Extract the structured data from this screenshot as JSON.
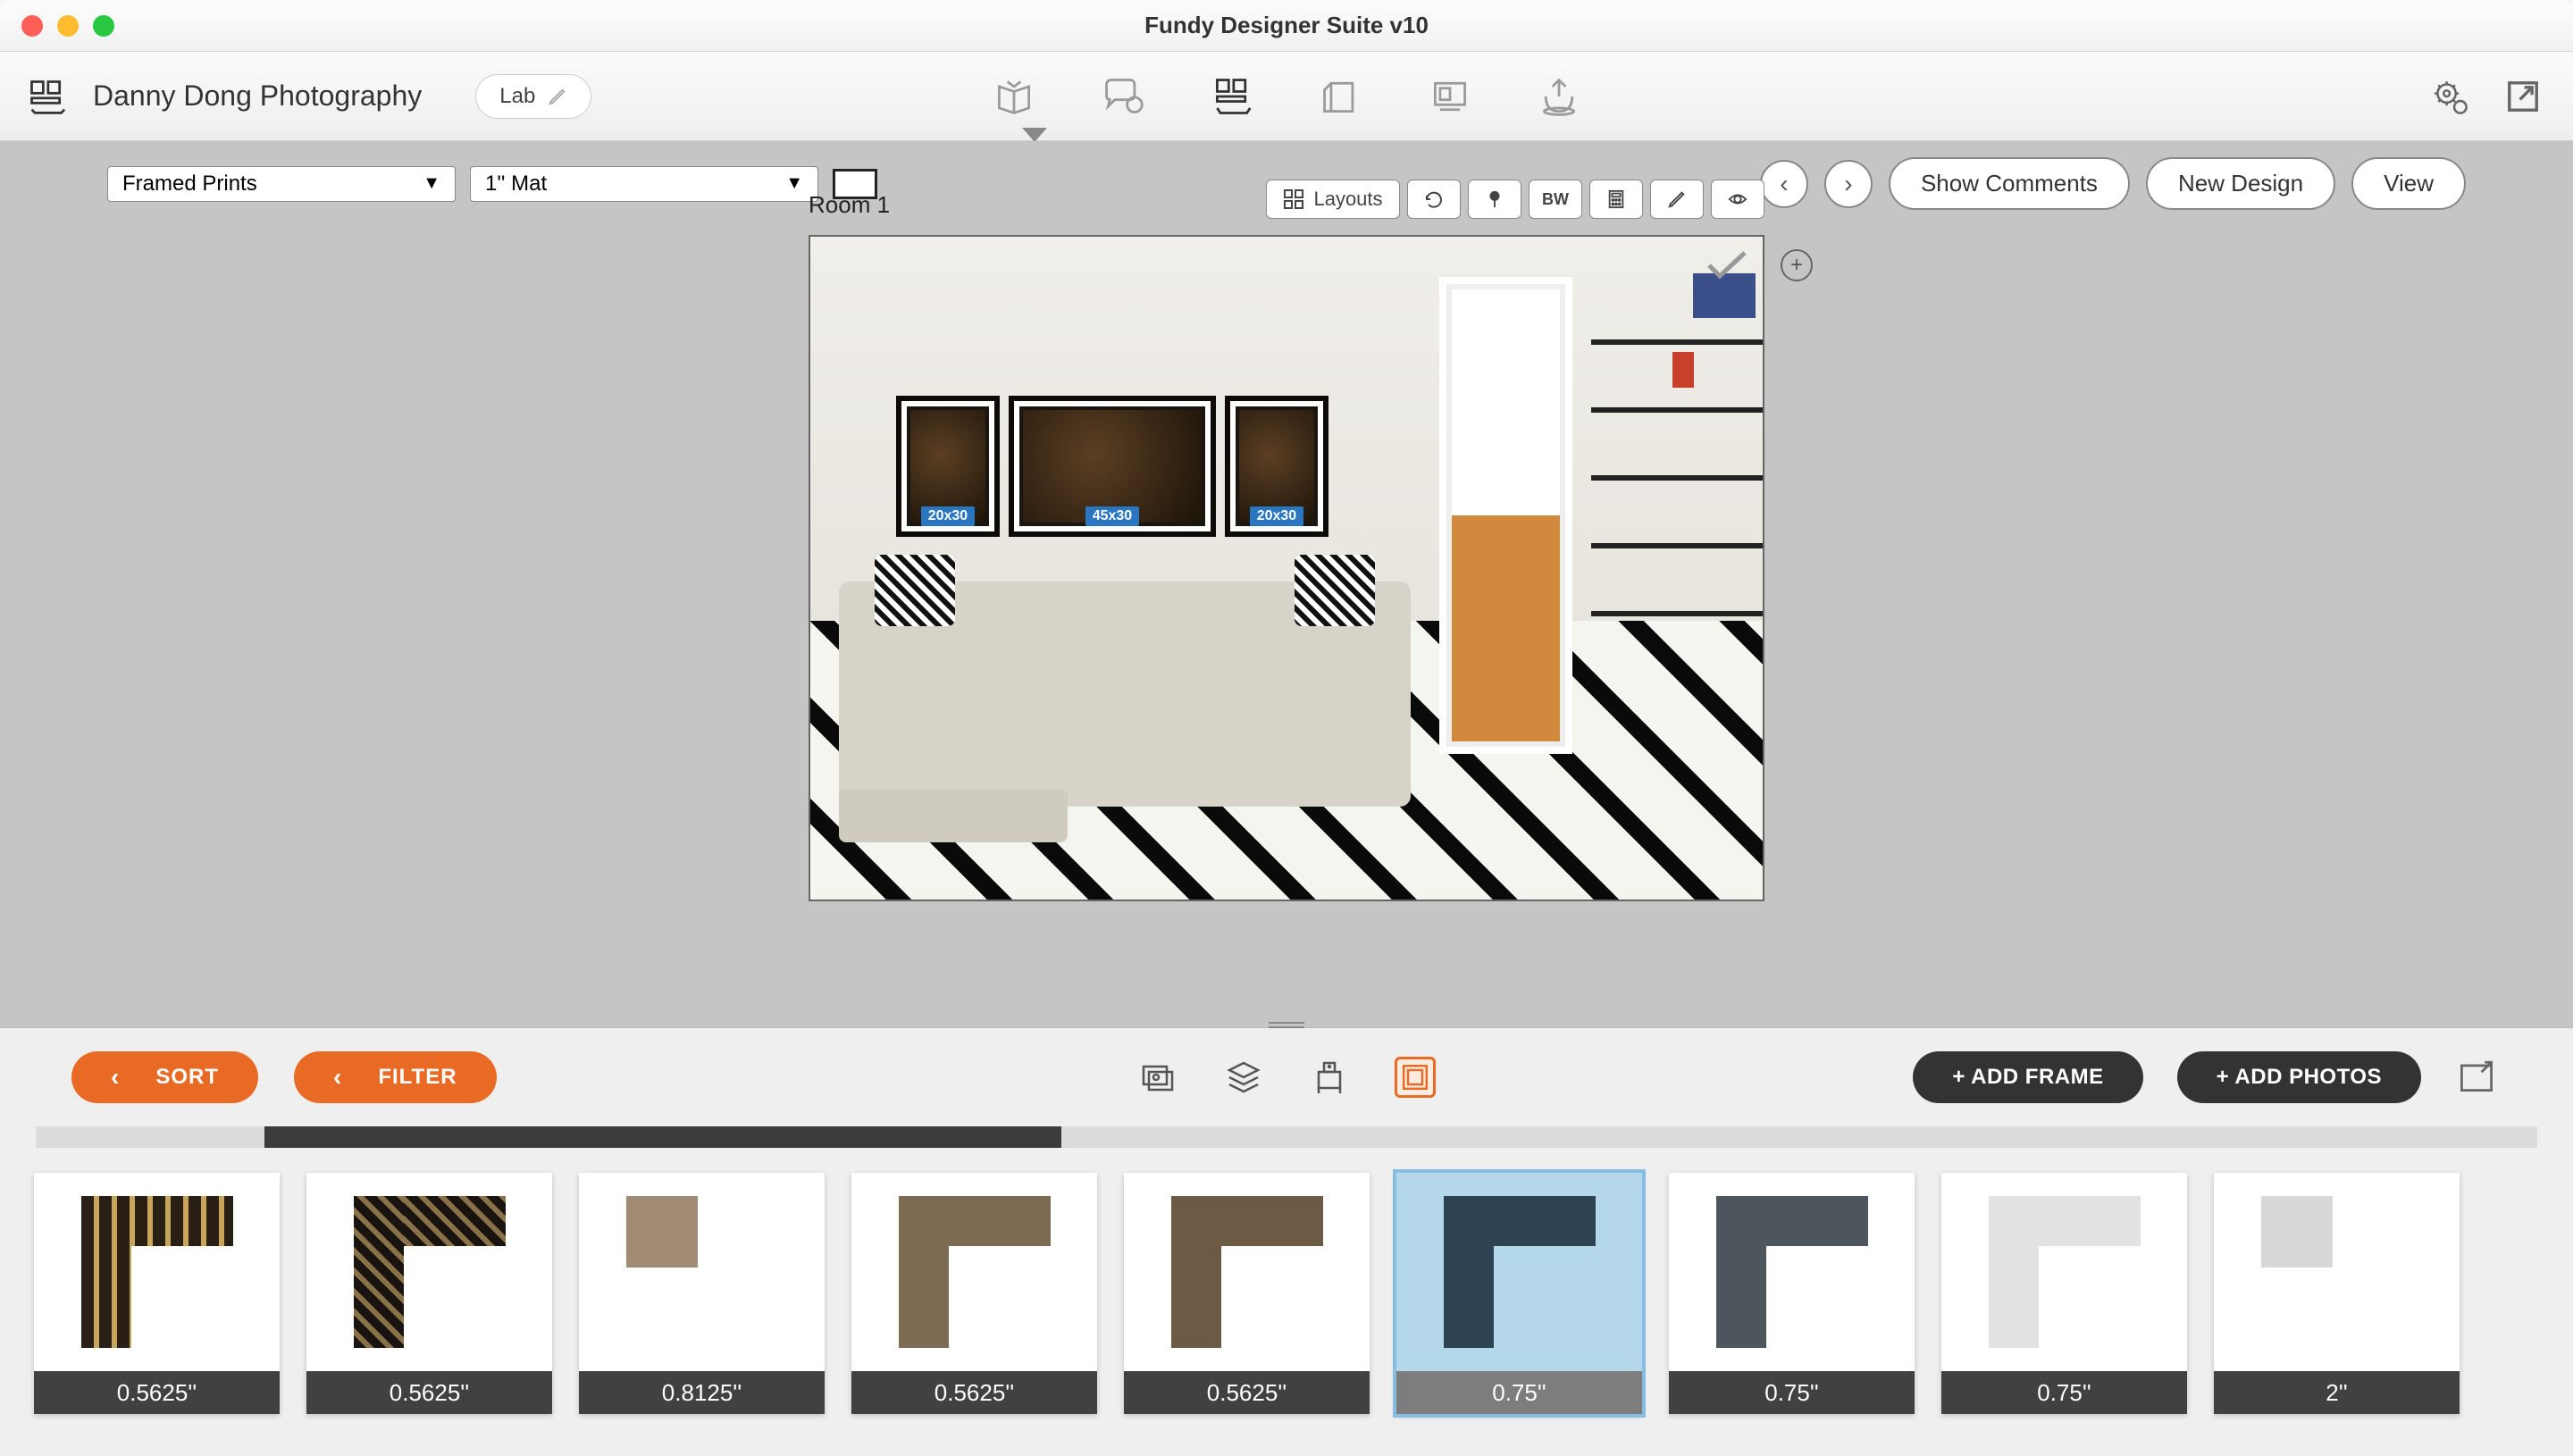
{
  "window": {
    "title": "Fundy Designer Suite v10"
  },
  "toolbar": {
    "project_name": "Danny Dong Photography",
    "lab_label": "Lab",
    "modes": [
      "album-icon",
      "comments-icon",
      "wall-design-icon",
      "cards-icon",
      "slideshow-icon",
      "export-icon"
    ]
  },
  "workspace": {
    "product_type": "Framed Prints",
    "mat_option": "1'' Mat",
    "room_label": "Room 1",
    "tools": {
      "layouts": "Layouts",
      "bw": "BW"
    },
    "wall_frames": [
      {
        "size_label": "20x30"
      },
      {
        "size_label": "45x30"
      },
      {
        "size_label": "20x30"
      }
    ],
    "buttons": {
      "show_comments": "Show Comments",
      "new_design": "New Design",
      "view": "View"
    }
  },
  "panel": {
    "sort_label": "SORT",
    "filter_label": "FILTER",
    "add_frame": "+ ADD FRAME",
    "add_photos": "+ ADD PHOTOS",
    "frames": [
      {
        "size": "0.5625''",
        "style": "ornate1",
        "selected": false
      },
      {
        "size": "0.5625''",
        "style": "ornate2",
        "selected": false
      },
      {
        "size": "0.8125''",
        "style": "wood1",
        "selected": false
      },
      {
        "size": "0.5625''",
        "style": "wood2",
        "selected": false
      },
      {
        "size": "0.5625''",
        "style": "wood3",
        "selected": false
      },
      {
        "size": "0.75''",
        "style": "char",
        "selected": true
      },
      {
        "size": "0.75''",
        "style": "slate",
        "selected": false
      },
      {
        "size": "0.75''",
        "style": "lt1",
        "selected": false
      },
      {
        "size": "2''",
        "style": "lt2",
        "selected": false
      }
    ]
  },
  "colors": {
    "accent": "#e86a24",
    "selection": "#b5d7ea"
  }
}
